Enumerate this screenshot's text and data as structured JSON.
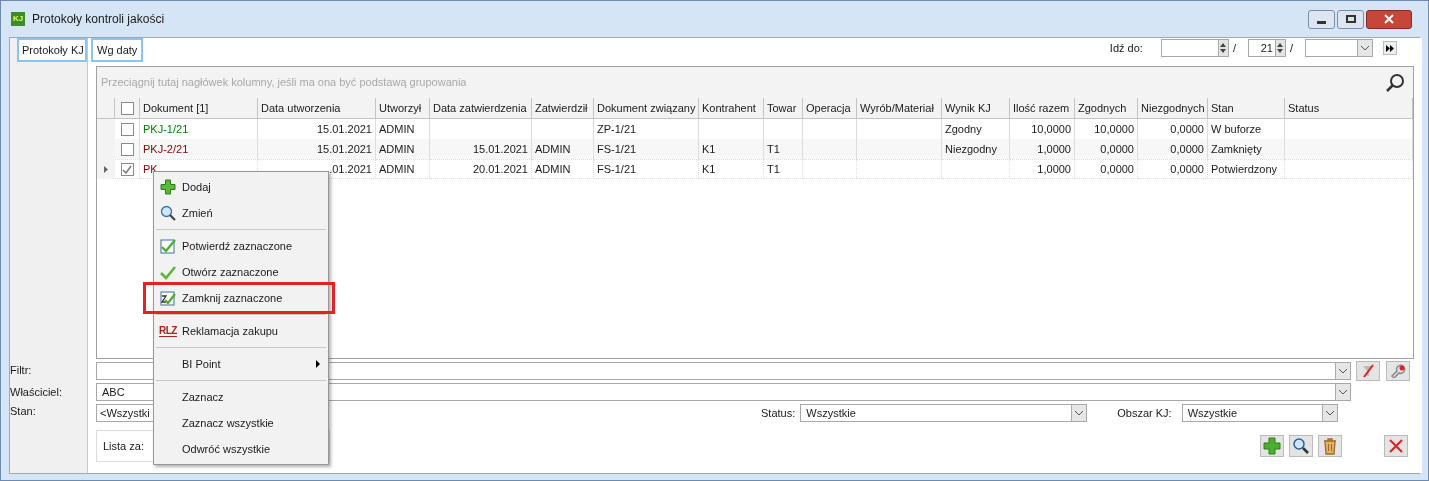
{
  "window": {
    "title": "Protokoły kontroli jakości",
    "badge": "KJ"
  },
  "sidebar_tabs": [
    {
      "label": "Protokoły KJ",
      "selected": true
    }
  ],
  "tabs": [
    {
      "label": "Wg daty",
      "selected": true
    }
  ],
  "goto": {
    "label": "Idź do:",
    "year": "21",
    "separator": "/"
  },
  "grid": {
    "group_hint": "Przeciągnij tutaj nagłówek kolumny, jeśli ma ona być podstawą grupowania",
    "all_checked": false,
    "columns": [
      "Dokument [1]",
      "Data utworzenia",
      "Utworzył",
      "Data zatwierdzenia",
      "Zatwierdził",
      "Dokument związany",
      "Kontrahent",
      "Towar",
      "Operacja",
      "Wyrób/Materiał",
      "Wynik KJ",
      "Ilość razem",
      "Zgodnych",
      "Niezgodnych",
      "Stan",
      "Status"
    ],
    "rows": [
      {
        "current": false,
        "checked": false,
        "color": "#008000",
        "cells": [
          "PKJ-1/21",
          "15.01.2021",
          "ADMIN",
          "",
          "",
          "ZP-1/21",
          "",
          "",
          "",
          "",
          "Zgodny",
          "10,0000",
          "10,0000",
          "0,0000",
          "W buforze",
          ""
        ]
      },
      {
        "current": false,
        "checked": false,
        "color": "#8b0000",
        "cells": [
          "PKJ-2/21",
          "15.01.2021",
          "ADMIN",
          "15.01.2021",
          "ADMIN",
          "FS-1/21",
          "K1",
          "T1",
          "",
          "",
          "Niezgodny",
          "1,0000",
          "0,0000",
          "0,0000",
          "Zamknięty",
          ""
        ]
      },
      {
        "current": true,
        "checked": true,
        "color": "#8b0000",
        "cells": [
          "PK",
          ".01.2021",
          "ADMIN",
          "20.01.2021",
          "ADMIN",
          "FS-1/21",
          "K1",
          "T1",
          "",
          "",
          "",
          "1,0000",
          "0,0000",
          "0,0000",
          "Potwierdzony",
          ""
        ]
      }
    ]
  },
  "context_menu": [
    {
      "kind": "item",
      "label": "Dodaj",
      "highlighted": false
    },
    {
      "kind": "item",
      "label": "Zmień",
      "highlighted": false
    },
    {
      "kind": "separator"
    },
    {
      "kind": "item",
      "label": "Potwierdź zaznaczone",
      "highlighted": false
    },
    {
      "kind": "item",
      "label": "Otwórz zaznaczone",
      "highlighted": false
    },
    {
      "kind": "item",
      "label": "Zamknij zaznaczone",
      "highlighted": true
    },
    {
      "kind": "separator"
    },
    {
      "kind": "item",
      "label": "Reklamacja zakupu",
      "highlighted": false,
      "badge": "RLZ"
    },
    {
      "kind": "separator"
    },
    {
      "kind": "submenu",
      "label": "BI Point",
      "highlighted": false
    },
    {
      "kind": "separator"
    },
    {
      "kind": "item",
      "label": "Zaznacz",
      "highlighted": false
    },
    {
      "kind": "item",
      "label": "Zaznacz wszystkie",
      "highlighted": false
    },
    {
      "kind": "item",
      "label": "Odwróć wszystkie",
      "highlighted": false
    }
  ],
  "filters": {
    "filter_label": "Filtr:",
    "owner_label": "Właściciel:",
    "owner_value": "ABC",
    "state_label": "Stan:",
    "state_value": "<Wszystki",
    "status_label": "Status:",
    "status_value": "Wszystkie",
    "area_label": "Obszar KJ:",
    "area_value": "Wszystkie",
    "list_label": "Lista za:"
  }
}
